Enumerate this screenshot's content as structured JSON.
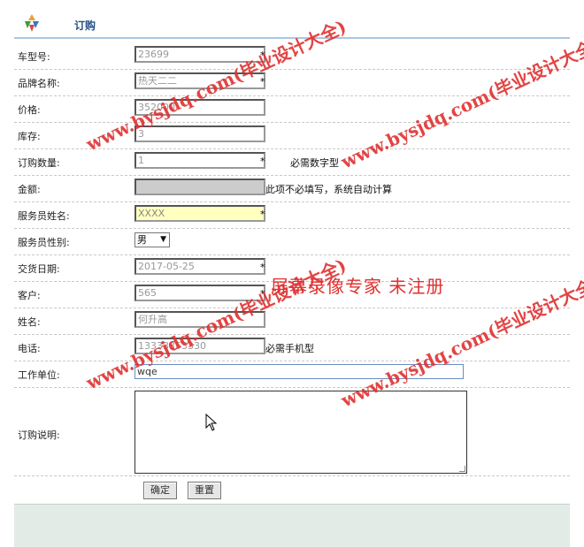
{
  "header": {
    "title": "订购"
  },
  "form": {
    "car_model_no": {
      "label": "车型号:",
      "value": "23699",
      "required": "*"
    },
    "brand_name": {
      "label": "品牌名称:",
      "value": "热天二二",
      "required": "*"
    },
    "price": {
      "label": "价格:",
      "value": "352000"
    },
    "stock": {
      "label": "库存:",
      "value": "3"
    },
    "order_qty": {
      "label": "订购数量:",
      "value": "1",
      "required": "*",
      "hint": "必需数字型"
    },
    "amount": {
      "label": "金额:",
      "value": "",
      "hint": "此项不必填写，系统自动计算"
    },
    "staff_name": {
      "label": "服务员姓名:",
      "value": "XXXX",
      "required": "*"
    },
    "staff_gender": {
      "label": "服务员性别:",
      "value": "男"
    },
    "delivery_date": {
      "label": "交货日期:",
      "value": "2017-05-25",
      "required": "*"
    },
    "customer": {
      "label": "客户:",
      "value": "565",
      "required": "*"
    },
    "name": {
      "label": "姓名:",
      "value": "何升高"
    },
    "phone": {
      "label": "电话:",
      "value": "13333353330",
      "hint": "必需手机型"
    },
    "work_unit": {
      "label": "工作单位:",
      "value": "wqe"
    },
    "order_note": {
      "label": "订购说明:",
      "value": ""
    }
  },
  "buttons": {
    "confirm": "确定",
    "reset": "重置"
  },
  "watermarks": {
    "site": "www.bysjdq.com(毕业设计大全)",
    "recorder": "屏幕录像专家  未注册"
  },
  "colors": {
    "accent": "#234f86",
    "watermark": "#e03030",
    "highlight_input": "#ffffc0",
    "disabled_input": "#cccccc"
  }
}
